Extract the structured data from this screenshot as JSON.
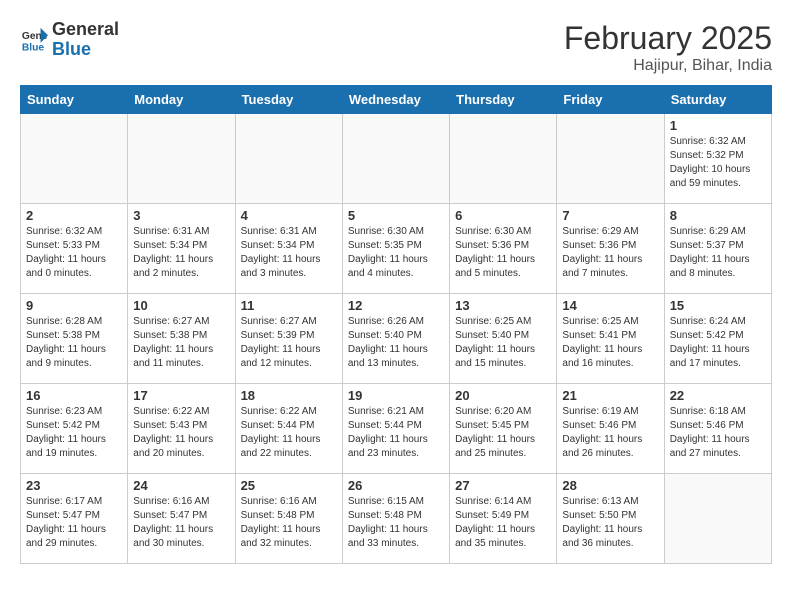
{
  "header": {
    "logo_general": "General",
    "logo_blue": "Blue",
    "month": "February 2025",
    "location": "Hajipur, Bihar, India"
  },
  "weekdays": [
    "Sunday",
    "Monday",
    "Tuesday",
    "Wednesday",
    "Thursday",
    "Friday",
    "Saturday"
  ],
  "weeks": [
    [
      {
        "day": "",
        "text": ""
      },
      {
        "day": "",
        "text": ""
      },
      {
        "day": "",
        "text": ""
      },
      {
        "day": "",
        "text": ""
      },
      {
        "day": "",
        "text": ""
      },
      {
        "day": "",
        "text": ""
      },
      {
        "day": "1",
        "text": "Sunrise: 6:32 AM\nSunset: 5:32 PM\nDaylight: 10 hours\nand 59 minutes."
      }
    ],
    [
      {
        "day": "2",
        "text": "Sunrise: 6:32 AM\nSunset: 5:33 PM\nDaylight: 11 hours\nand 0 minutes."
      },
      {
        "day": "3",
        "text": "Sunrise: 6:31 AM\nSunset: 5:34 PM\nDaylight: 11 hours\nand 2 minutes."
      },
      {
        "day": "4",
        "text": "Sunrise: 6:31 AM\nSunset: 5:34 PM\nDaylight: 11 hours\nand 3 minutes."
      },
      {
        "day": "5",
        "text": "Sunrise: 6:30 AM\nSunset: 5:35 PM\nDaylight: 11 hours\nand 4 minutes."
      },
      {
        "day": "6",
        "text": "Sunrise: 6:30 AM\nSunset: 5:36 PM\nDaylight: 11 hours\nand 5 minutes."
      },
      {
        "day": "7",
        "text": "Sunrise: 6:29 AM\nSunset: 5:36 PM\nDaylight: 11 hours\nand 7 minutes."
      },
      {
        "day": "8",
        "text": "Sunrise: 6:29 AM\nSunset: 5:37 PM\nDaylight: 11 hours\nand 8 minutes."
      }
    ],
    [
      {
        "day": "9",
        "text": "Sunrise: 6:28 AM\nSunset: 5:38 PM\nDaylight: 11 hours\nand 9 minutes."
      },
      {
        "day": "10",
        "text": "Sunrise: 6:27 AM\nSunset: 5:38 PM\nDaylight: 11 hours\nand 11 minutes."
      },
      {
        "day": "11",
        "text": "Sunrise: 6:27 AM\nSunset: 5:39 PM\nDaylight: 11 hours\nand 12 minutes."
      },
      {
        "day": "12",
        "text": "Sunrise: 6:26 AM\nSunset: 5:40 PM\nDaylight: 11 hours\nand 13 minutes."
      },
      {
        "day": "13",
        "text": "Sunrise: 6:25 AM\nSunset: 5:40 PM\nDaylight: 11 hours\nand 15 minutes."
      },
      {
        "day": "14",
        "text": "Sunrise: 6:25 AM\nSunset: 5:41 PM\nDaylight: 11 hours\nand 16 minutes."
      },
      {
        "day": "15",
        "text": "Sunrise: 6:24 AM\nSunset: 5:42 PM\nDaylight: 11 hours\nand 17 minutes."
      }
    ],
    [
      {
        "day": "16",
        "text": "Sunrise: 6:23 AM\nSunset: 5:42 PM\nDaylight: 11 hours\nand 19 minutes."
      },
      {
        "day": "17",
        "text": "Sunrise: 6:22 AM\nSunset: 5:43 PM\nDaylight: 11 hours\nand 20 minutes."
      },
      {
        "day": "18",
        "text": "Sunrise: 6:22 AM\nSunset: 5:44 PM\nDaylight: 11 hours\nand 22 minutes."
      },
      {
        "day": "19",
        "text": "Sunrise: 6:21 AM\nSunset: 5:44 PM\nDaylight: 11 hours\nand 23 minutes."
      },
      {
        "day": "20",
        "text": "Sunrise: 6:20 AM\nSunset: 5:45 PM\nDaylight: 11 hours\nand 25 minutes."
      },
      {
        "day": "21",
        "text": "Sunrise: 6:19 AM\nSunset: 5:46 PM\nDaylight: 11 hours\nand 26 minutes."
      },
      {
        "day": "22",
        "text": "Sunrise: 6:18 AM\nSunset: 5:46 PM\nDaylight: 11 hours\nand 27 minutes."
      }
    ],
    [
      {
        "day": "23",
        "text": "Sunrise: 6:17 AM\nSunset: 5:47 PM\nDaylight: 11 hours\nand 29 minutes."
      },
      {
        "day": "24",
        "text": "Sunrise: 6:16 AM\nSunset: 5:47 PM\nDaylight: 11 hours\nand 30 minutes."
      },
      {
        "day": "25",
        "text": "Sunrise: 6:16 AM\nSunset: 5:48 PM\nDaylight: 11 hours\nand 32 minutes."
      },
      {
        "day": "26",
        "text": "Sunrise: 6:15 AM\nSunset: 5:48 PM\nDaylight: 11 hours\nand 33 minutes."
      },
      {
        "day": "27",
        "text": "Sunrise: 6:14 AM\nSunset: 5:49 PM\nDaylight: 11 hours\nand 35 minutes."
      },
      {
        "day": "28",
        "text": "Sunrise: 6:13 AM\nSunset: 5:50 PM\nDaylight: 11 hours\nand 36 minutes."
      },
      {
        "day": "",
        "text": ""
      }
    ]
  ]
}
